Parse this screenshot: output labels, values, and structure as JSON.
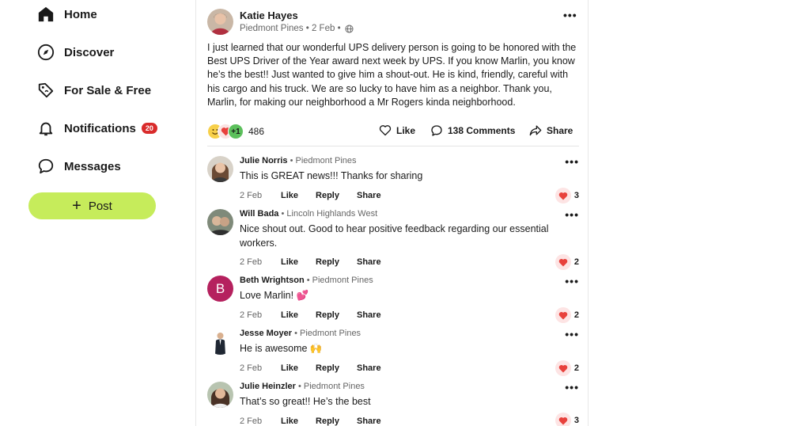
{
  "sidebar": {
    "items": [
      {
        "label": "Home",
        "icon": "home-icon"
      },
      {
        "label": "Discover",
        "icon": "compass-icon"
      },
      {
        "label": "For Sale & Free",
        "icon": "price-tag-icon"
      },
      {
        "label": "Notifications",
        "icon": "bell-icon",
        "badge": "20"
      },
      {
        "label": "Messages",
        "icon": "chat-bubble-icon"
      }
    ],
    "post_label": "Post"
  },
  "post": {
    "author": "Katie Hayes",
    "neighborhood": "Piedmont Pines",
    "date": "2 Feb",
    "body": "I just learned that our wonderful UPS delivery person is going to be honored with the Best UPS Driver of the Year award next week by UPS. If you know Marlin, you know he’s the best!! Just wanted to give him a shout-out. He is kind, friendly, careful with his cargo and his truck. We are so lucky to have him as a neighbor. Thank you, Marlin, for making our neighborhood a Mr Rogers kinda neighborhood.",
    "reaction_extra": "+1",
    "reaction_count": "486",
    "like_label": "Like",
    "comments_label": "138 Comments",
    "share_label": "Share"
  },
  "comment_actions": {
    "like": "Like",
    "reply": "Reply",
    "share": "Share"
  },
  "comments": [
    {
      "name": "Julie Norris",
      "hood": "Piedmont Pines",
      "text": "This is GREAT news!!!  Thanks for sharing",
      "date": "2 Feb",
      "likes": "3",
      "avatar_initial": ""
    },
    {
      "name": "Will Bada",
      "hood": "Lincoln Highlands West",
      "text": "Nice shout out.  Good to hear positive feedback regarding our essential workers.",
      "date": "2 Feb",
      "likes": "2",
      "avatar_initial": ""
    },
    {
      "name": "Beth Wrightson",
      "hood": "Piedmont Pines",
      "text": "Love Marlin! 💕",
      "date": "2 Feb",
      "likes": "2",
      "avatar_initial": "B"
    },
    {
      "name": "Jesse Moyer",
      "hood": "Piedmont Pines",
      "text": "He is awesome 🙌",
      "date": "2 Feb",
      "likes": "2",
      "avatar_initial": ""
    },
    {
      "name": "Julie Heinzler",
      "hood": "Piedmont Pines",
      "text": "That’s so great!! He’s the best",
      "date": "2 Feb",
      "likes": "3",
      "avatar_initial": ""
    }
  ],
  "colors": {
    "accent_green": "#c6ec5b",
    "badge_red": "#d92b2b",
    "heart_red": "#e8413c",
    "avatar_purple": "#b5215e"
  }
}
